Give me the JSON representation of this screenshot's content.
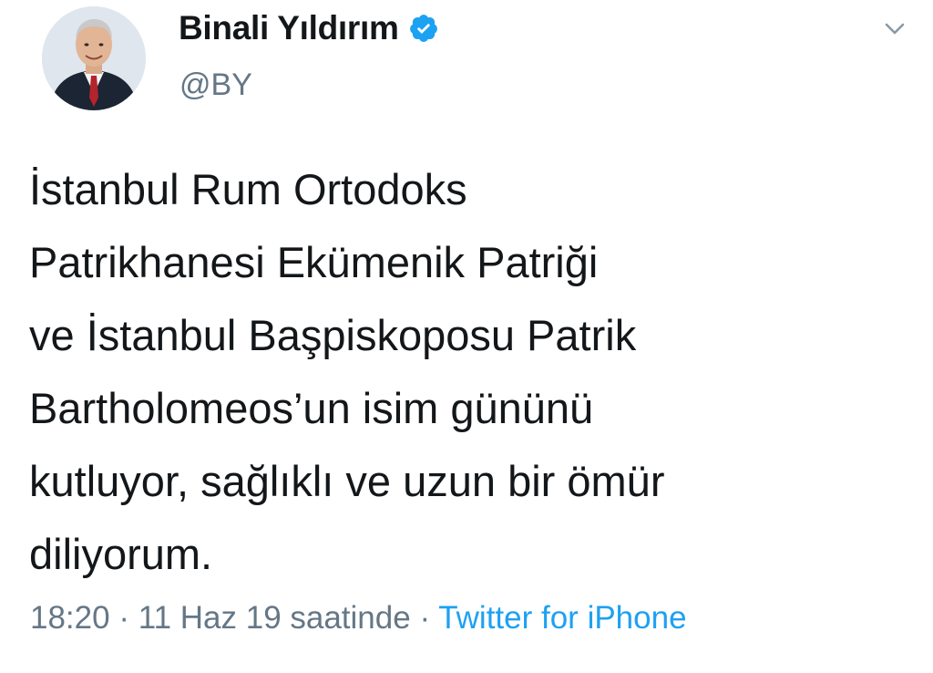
{
  "user": {
    "display_name": "Binali Yıldırım",
    "handle": "@BY",
    "verified": true
  },
  "header": {
    "menu_icon": "chevron-down-icon",
    "verified_icon": "verified-badge-icon"
  },
  "tweet": {
    "lines": [
      "İstanbul Rum Ortodoks",
      "Patrikhanesi Ekümenik Patriği",
      "ve İstanbul Başpiskoposu Patrik",
      "Bartholomeos’un isim gününü",
      "kutluyor, sağlıklı ve uzun bir ömür",
      "diliyorum."
    ]
  },
  "meta": {
    "time": "18:20",
    "separator": " · ",
    "date": "11 Haz 19 saatinde",
    "source": "Twitter for iPhone"
  },
  "colors": {
    "text": "#14171a",
    "secondary": "#657786",
    "accent": "#1da1f2"
  }
}
